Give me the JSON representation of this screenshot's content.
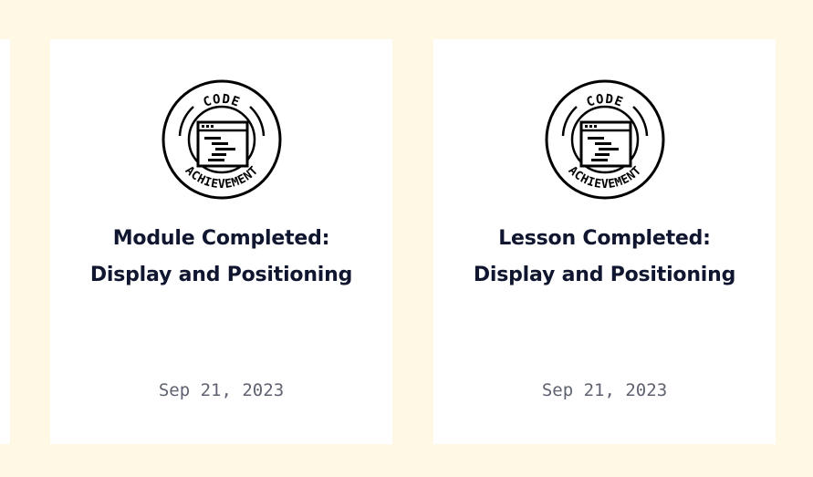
{
  "badge": {
    "icon": "code-achievement-badge-icon",
    "top_text": "CODE",
    "bottom_text": "ACHIEVEMENT"
  },
  "cards": [
    {
      "title_line1": "Module Completed:",
      "title_line2": "Display and Positioning",
      "date": "Sep 21, 2023"
    },
    {
      "title_line1": "Lesson Completed:",
      "title_line2": "Display and Positioning",
      "date": "Sep 21, 2023"
    }
  ],
  "colors": {
    "page_background": "#fff8e5",
    "card_background": "#ffffff",
    "title_text": "#10162f",
    "date_text": "#5f6270",
    "badge_ink": "#000000"
  }
}
